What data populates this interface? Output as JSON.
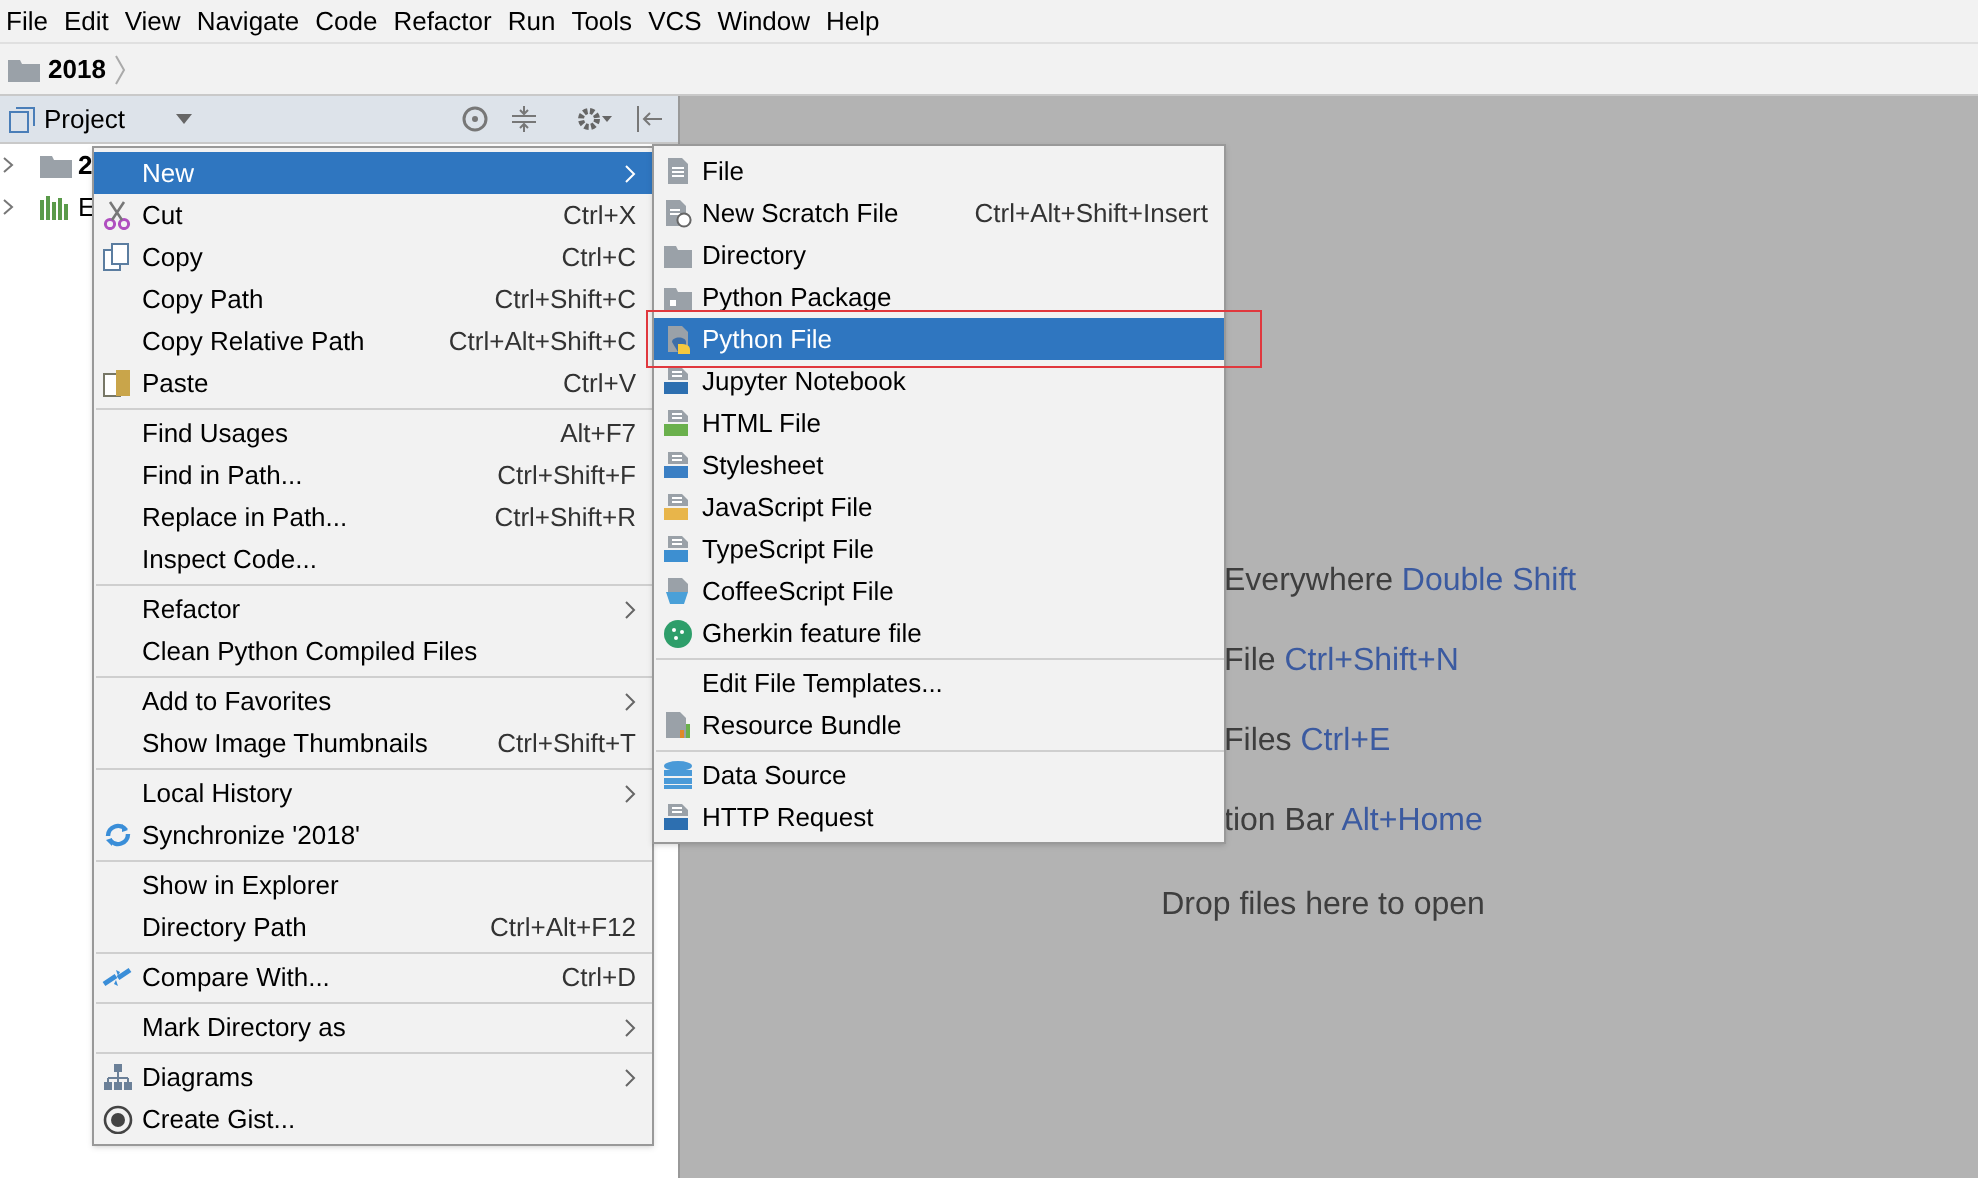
{
  "menu_bar": [
    "File",
    "Edit",
    "View",
    "Navigate",
    "Code",
    "Refactor",
    "Run",
    "Tools",
    "VCS",
    "Window",
    "Help"
  ],
  "breadcrumb": {
    "label": "2018"
  },
  "project_panel": {
    "title": "Project",
    "tree": [
      {
        "label": "2",
        "bold": true
      },
      {
        "label": "E",
        "bold": false
      }
    ]
  },
  "context_menu": [
    {
      "kind": "item",
      "label": "New",
      "submenu": true,
      "selected": true
    },
    {
      "kind": "item",
      "label": "Cut",
      "shortcut": "Ctrl+X",
      "selected": false
    },
    {
      "kind": "item",
      "label": "Copy",
      "shortcut": "Ctrl+C",
      "selected": false
    },
    {
      "kind": "item",
      "label": "Copy Path",
      "shortcut": "Ctrl+Shift+C",
      "selected": false
    },
    {
      "kind": "item",
      "label": "Copy Relative Path",
      "shortcut": "Ctrl+Alt+Shift+C",
      "selected": false
    },
    {
      "kind": "item",
      "label": "Paste",
      "shortcut": "Ctrl+V",
      "selected": false
    },
    {
      "kind": "separator"
    },
    {
      "kind": "item",
      "label": "Find Usages",
      "shortcut": "Alt+F7",
      "selected": false
    },
    {
      "kind": "item",
      "label": "Find in Path...",
      "shortcut": "Ctrl+Shift+F",
      "selected": false
    },
    {
      "kind": "item",
      "label": "Replace in Path...",
      "shortcut": "Ctrl+Shift+R",
      "selected": false
    },
    {
      "kind": "item",
      "label": "Inspect Code...",
      "selected": false
    },
    {
      "kind": "separator"
    },
    {
      "kind": "item",
      "label": "Refactor",
      "submenu": true,
      "selected": false
    },
    {
      "kind": "item",
      "label": "Clean Python Compiled Files",
      "selected": false
    },
    {
      "kind": "separator"
    },
    {
      "kind": "item",
      "label": "Add to Favorites",
      "submenu": true,
      "selected": false
    },
    {
      "kind": "item",
      "label": "Show Image Thumbnails",
      "shortcut": "Ctrl+Shift+T",
      "selected": false
    },
    {
      "kind": "separator"
    },
    {
      "kind": "item",
      "label": "Local History",
      "submenu": true,
      "selected": false
    },
    {
      "kind": "item",
      "label": "Synchronize '2018'",
      "selected": false
    },
    {
      "kind": "separator"
    },
    {
      "kind": "item",
      "label": "Show in Explorer",
      "selected": false
    },
    {
      "kind": "item",
      "label": "Directory Path",
      "shortcut": "Ctrl+Alt+F12",
      "selected": false
    },
    {
      "kind": "separator"
    },
    {
      "kind": "item",
      "label": "Compare With...",
      "shortcut": "Ctrl+D",
      "selected": false
    },
    {
      "kind": "separator"
    },
    {
      "kind": "item",
      "label": "Mark Directory as",
      "submenu": true,
      "selected": false
    },
    {
      "kind": "separator"
    },
    {
      "kind": "item",
      "label": "Diagrams",
      "submenu": true,
      "selected": false
    },
    {
      "kind": "item",
      "label": "Create Gist...",
      "selected": false
    }
  ],
  "new_submenu": [
    {
      "kind": "item",
      "label": "File",
      "selected": false
    },
    {
      "kind": "item",
      "label": "New Scratch File",
      "shortcut": "Ctrl+Alt+Shift+Insert",
      "selected": false
    },
    {
      "kind": "item",
      "label": "Directory",
      "selected": false
    },
    {
      "kind": "item",
      "label": "Python Package",
      "selected": false
    },
    {
      "kind": "item",
      "label": "Python File",
      "selected": true
    },
    {
      "kind": "item",
      "label": "Jupyter Notebook",
      "selected": false
    },
    {
      "kind": "item",
      "label": "HTML File",
      "selected": false
    },
    {
      "kind": "item",
      "label": "Stylesheet",
      "selected": false
    },
    {
      "kind": "item",
      "label": "JavaScript File",
      "selected": false
    },
    {
      "kind": "item",
      "label": "TypeScript File",
      "selected": false
    },
    {
      "kind": "item",
      "label": "CoffeeScript File",
      "selected": false
    },
    {
      "kind": "item",
      "label": "Gherkin feature file",
      "selected": false
    },
    {
      "kind": "separator"
    },
    {
      "kind": "item",
      "label": "Edit File Templates...",
      "selected": false
    },
    {
      "kind": "item",
      "label": "Resource Bundle",
      "selected": false
    },
    {
      "kind": "separator"
    },
    {
      "kind": "item",
      "label": "Data Source",
      "selected": false
    },
    {
      "kind": "item",
      "label": "HTTP Request",
      "selected": false
    }
  ],
  "editor_hints": [
    {
      "text": "Everywhere",
      "shortcut": "Double Shift"
    },
    {
      "text": "File",
      "shortcut": "Ctrl+Shift+N"
    },
    {
      "text": "Files",
      "shortcut": "Ctrl+E"
    },
    {
      "text": "tion Bar",
      "shortcut": "Alt+Home"
    }
  ],
  "drop_hint": "Drop files here to open"
}
